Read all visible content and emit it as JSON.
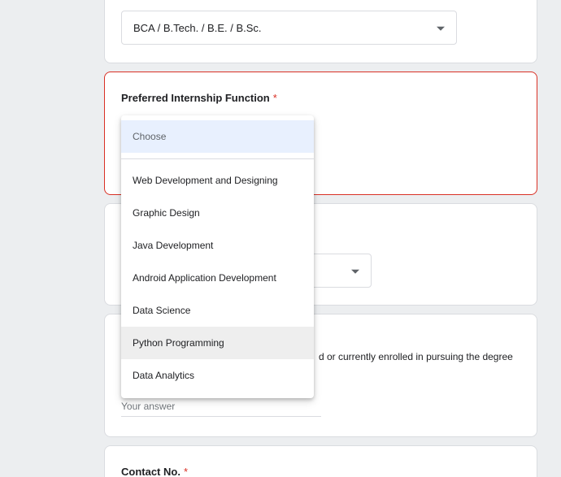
{
  "degree_question": {
    "selected_value": "BCA / B.Tech. / B.E. / B.Sc."
  },
  "function_question": {
    "title": "Preferred Internship Function",
    "required_mark": "*",
    "dropdown": {
      "placeholder": "Choose",
      "options": [
        "Web Development and Designing",
        "Graphic Design",
        "Java Development",
        "Android Application Development",
        "Data Science",
        "Python Programming",
        "Data Analytics"
      ],
      "hovered_option": "Python Programming"
    }
  },
  "q4": {
    "description_visible": "d or currently enrolled in pursuing the degree",
    "answer_placeholder": "Your answer"
  },
  "contact_question": {
    "title": "Contact No.",
    "required_mark": "*"
  },
  "colors": {
    "error_border": "#d93025",
    "required_star": "#d93025",
    "placeholder_highlight": "#e8f0fe",
    "hover_highlight": "#eeeeee",
    "page_background": "#eceef0"
  }
}
